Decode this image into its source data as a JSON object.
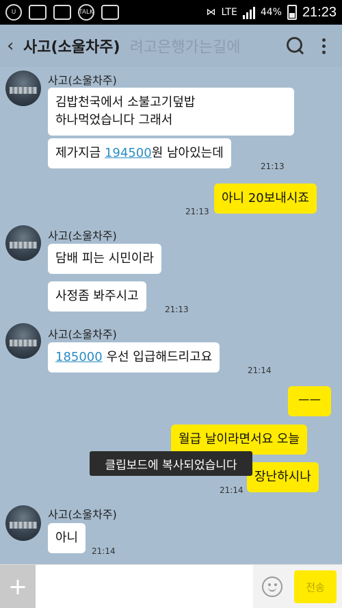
{
  "status_bar": {
    "battery_percent": "44%",
    "time": "21:23",
    "network": "LTE",
    "talk_icon_label": "TALK"
  },
  "header": {
    "back_glyph": "‹",
    "title": "사고(소울차주)",
    "ghost_text": "려고은행가는길에"
  },
  "messages": {
    "g1": {
      "sender": "사고(소울차주)",
      "b1_line1": "김밥천국에서 소불고기덮밥",
      "b1_line2": "하나먹었습니다 그래서",
      "b2_prefix": "제가지금 ",
      "b2_link": "194500",
      "b2_suffix": "원 남아있는데",
      "time": "21:13"
    },
    "m1": {
      "text": "아니 20보내시죠",
      "time": "21:13"
    },
    "g2": {
      "sender": "사고(소울차주)",
      "b1": "담배 피는 시민이라",
      "b2": "사정좀 봐주시고",
      "time": "21:13"
    },
    "g3": {
      "sender": "사고(소울차주)",
      "b1_link": "185000",
      "b1_suffix": " 우선 입급해드리고요",
      "time": "21:14"
    },
    "m2": {
      "b1": "ㅡㅡ",
      "b2": "월급 날이라면서요 오늘",
      "b3": "장난하시나",
      "time": "21:14"
    },
    "g4": {
      "sender": "사고(소울차주)",
      "b1": "아니",
      "time": "21:14"
    }
  },
  "toast": "클립보드에 복사되었습니다",
  "input_bar": {
    "plus_label": "+",
    "send_label": "전송"
  }
}
